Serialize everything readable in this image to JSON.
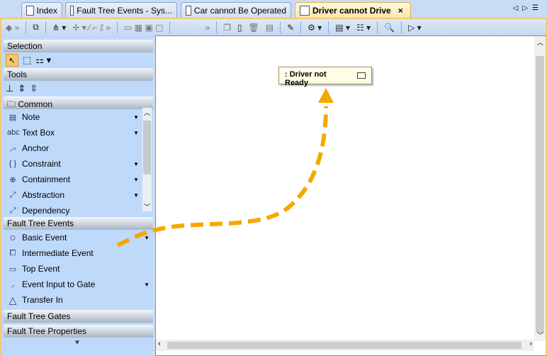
{
  "tabs": [
    {
      "label": "Index"
    },
    {
      "label": "Fault Tree  Events - Sys..."
    },
    {
      "label": "Car cannot Be Operated"
    },
    {
      "label": "Driver cannot Drive",
      "active": true
    }
  ],
  "tab_close": "×",
  "palette": {
    "selection": {
      "title": "Selection"
    },
    "tools": {
      "title": "Tools"
    },
    "common": {
      "title": "Common",
      "items": [
        {
          "label": "Note"
        },
        {
          "label": "Text Box",
          "icon": "abc"
        },
        {
          "label": "Anchor"
        },
        {
          "label": "Constraint",
          "icon": "{ }"
        },
        {
          "label": "Containment"
        },
        {
          "label": "Abstraction"
        },
        {
          "label": "Dependency"
        }
      ]
    },
    "fault_tree_events": {
      "title": "Fault Tree Events",
      "items": [
        {
          "label": "Basic Event"
        },
        {
          "label": "Intermediate Event"
        },
        {
          "label": "Top Event"
        },
        {
          "label": "Event Input to Gate"
        },
        {
          "label": "Transfer In"
        }
      ]
    },
    "fault_tree_gates": {
      "title": "Fault Tree Gates"
    },
    "fault_tree_properties": {
      "title": "Fault Tree Properties"
    }
  },
  "diagram": {
    "node_label": ": Driver not Ready"
  },
  "colors": {
    "arrow": "#f5a800",
    "accent": "#f3c878"
  }
}
